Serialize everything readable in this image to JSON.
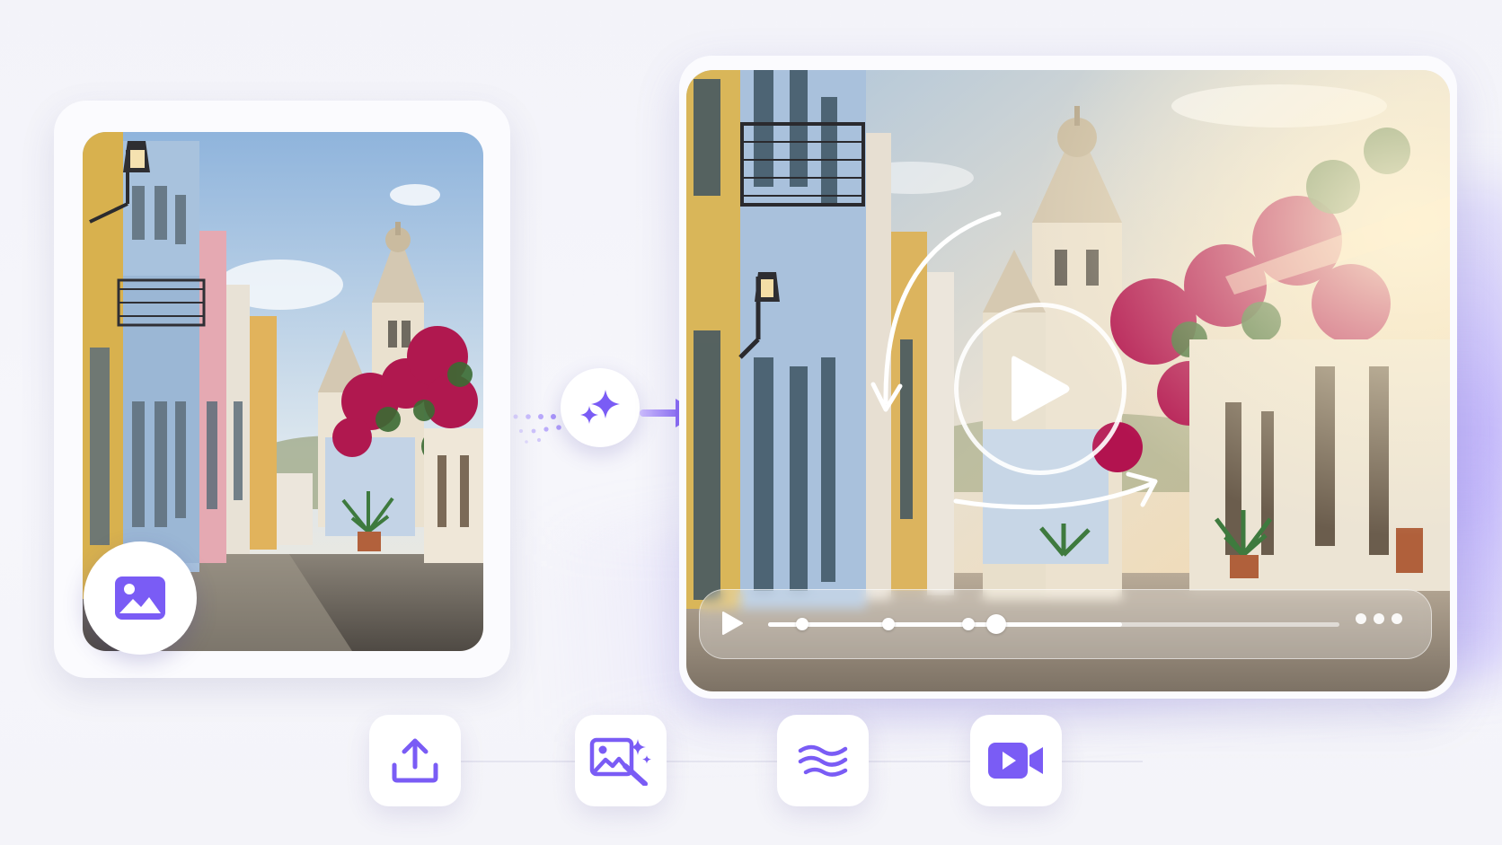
{
  "colors": {
    "accent": "#7a5cf5",
    "accent_light": "#a995fb",
    "card_bg": "#fbfbfe",
    "page_bg": "#f4f4f9"
  },
  "source": {
    "kind": "photo",
    "badge_icon": "image-icon"
  },
  "transform": {
    "button_icon": "sparkle-icon",
    "connector_icon": "arrow-right-icon"
  },
  "video": {
    "center_icon": "play-icon",
    "motion_icons": [
      "curved-arrow-down-icon",
      "curved-arrow-right-icon"
    ],
    "controls": {
      "play_icon": "play-icon",
      "more_icon": "more-dots-icon",
      "progress": 0.62,
      "playhead": 0.4,
      "keyframes": [
        0.06,
        0.21,
        0.35
      ]
    }
  },
  "steps": [
    {
      "icon": "upload-icon"
    },
    {
      "icon": "magic-image-icon"
    },
    {
      "icon": "motion-waves-icon"
    },
    {
      "icon": "video-camera-icon"
    }
  ]
}
